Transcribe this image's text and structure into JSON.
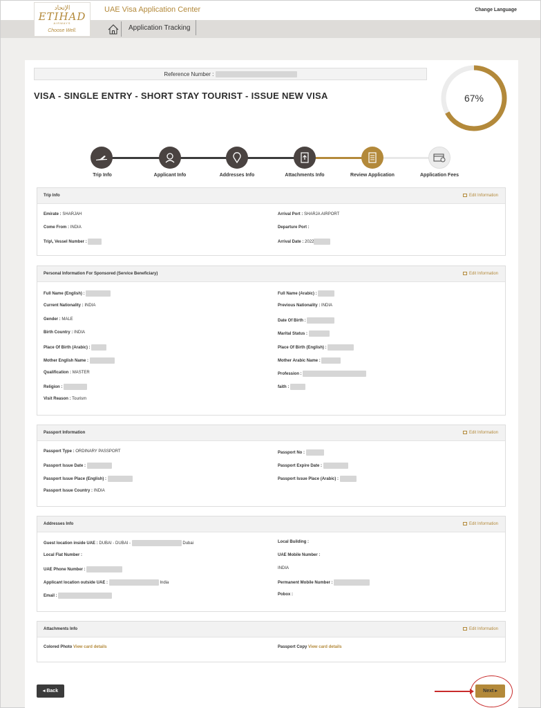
{
  "header": {
    "logo_arabic": "الإتحاد",
    "logo_name": "ETIHAD",
    "logo_sub": "AIRWAYS",
    "logo_tagline": "Choose Well.",
    "app_title": "UAE Visa Application Center",
    "change_language": "Change Language",
    "nav_tab": "Application Tracking"
  },
  "reference_label": "Reference Number :",
  "visa_title": "VISA - SINGLE ENTRY - SHORT STAY TOURIST - ISSUE NEW VISA",
  "progress": {
    "percent": 67,
    "label": "67%",
    "color": "#b3893a"
  },
  "steps": [
    {
      "label": "Trip Info",
      "state": "done",
      "icon": "plane-icon"
    },
    {
      "label": "Applicant Info",
      "state": "done",
      "icon": "person-icon"
    },
    {
      "label": "Addresses Info",
      "state": "done",
      "icon": "location-pin-icon"
    },
    {
      "label": "Attachments Info",
      "state": "done",
      "icon": "upload-document-icon"
    },
    {
      "label": "Review Application",
      "state": "active",
      "icon": "document-list-icon"
    },
    {
      "label": "Application Fees",
      "state": "pending",
      "icon": "payment-icon"
    }
  ],
  "edit_label": "Edit Information",
  "sections": {
    "trip": {
      "title": "Trip Info",
      "emirate_label": "Emirate :",
      "emirate_value": "SHARJAH",
      "arrival_port_label": "Arrival Port :",
      "arrival_port_value": "SHARJA AIRPORT",
      "come_from_label": "Come From :",
      "come_from_value": "INDIA",
      "departure_port_label": "Departure Port :",
      "trip_vessel_label": "Trip\\, Vessel Number :",
      "arrival_date_label": "Arrival Date :",
      "arrival_date_value": "2022"
    },
    "personal": {
      "title": "Personal Information For Sponsored (Service Beneficiary)",
      "full_name_en_label": "Full Name (English) :",
      "full_name_ar_label": "Full Name (Arabic) :",
      "current_nationality_label": "Current Nationality :",
      "current_nationality_value": "INDIA",
      "previous_nationality_label": "Previous Nationality :",
      "previous_nationality_value": "INDIA",
      "gender_label": "Gender :",
      "gender_value": "MALE",
      "dob_label": "Date Of Birth :",
      "birth_country_label": "Birth Country :",
      "birth_country_value": "INDIA",
      "marital_status_label": "Marital Status :",
      "pob_ar_label": "Place Of Birth (Arabic) :",
      "pob_en_label": "Place Of Birth (English) :",
      "mother_en_label": "Mother English Name :",
      "mother_ar_label": "Mother Arabic Name :",
      "qualification_label": "Qualification :",
      "qualification_value": "MASTER",
      "profession_label": "Profession :",
      "religion_label": "Religion :",
      "faith_label": "faith :",
      "visit_reason_label": "Visit Reason :",
      "visit_reason_value": "Tourism"
    },
    "passport": {
      "title": "Passport Information",
      "type_label": "Passport Type :",
      "type_value": "ORDINARY PASSPORT",
      "no_label": "Passport No :",
      "issue_date_label": "Passport Issue Date :",
      "expire_date_label": "Passport Expire Date :",
      "issue_place_en_label": "Passport Issue Place (English) :",
      "issue_place_ar_label": "Passport Issue Place (Arabic) :",
      "issue_country_label": "Passport Issue Country :",
      "issue_country_value": "INDIA"
    },
    "addresses": {
      "title": "Addresses Info",
      "guest_location_label": "Guest location inside UAE :",
      "guest_location_value": "DUBAI - DUBAI -",
      "guest_location_suffix": "Dubai",
      "local_building_label": "Local Building :",
      "local_flat_label": "Local Flat Number :",
      "uae_mobile_label": "UAE Mobile Number :",
      "uae_phone_label": "UAE Phone Number :",
      "country_value": "INDIA",
      "applicant_location_label": "Applicant location outside UAE :",
      "applicant_location_suffix": "India",
      "permanent_mobile_label": "Permanent Mobile Number :",
      "email_label": "Email :",
      "pobox_label": "Pobox :"
    },
    "attachments": {
      "title": "Attachments Info",
      "colored_photo_label": "Colored Photo",
      "colored_photo_link": "View card details",
      "passport_copy_label": "Passport Copy",
      "passport_copy_link": "View card details"
    }
  },
  "buttons": {
    "back": "Back",
    "next": "Next"
  }
}
